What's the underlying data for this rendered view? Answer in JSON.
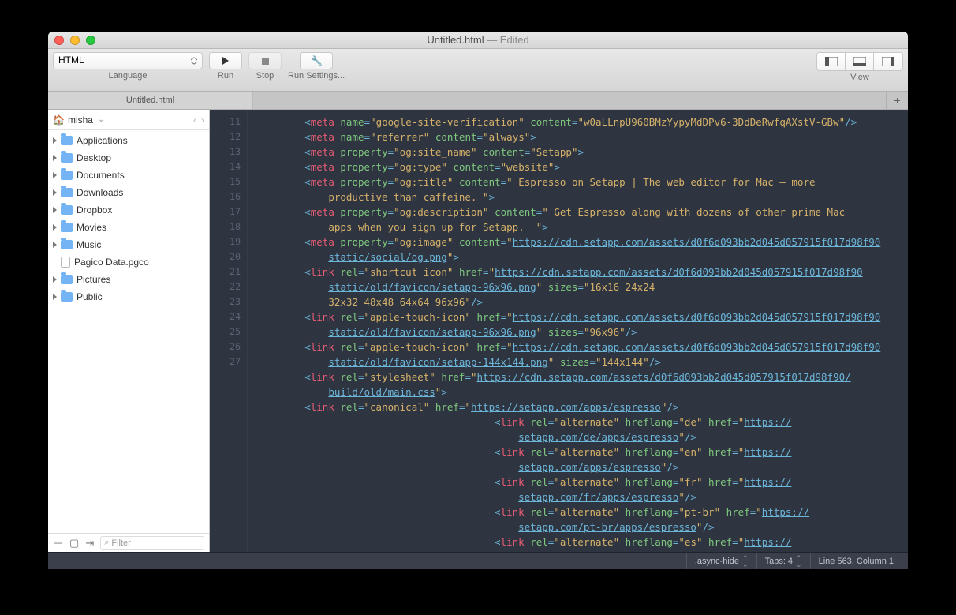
{
  "window": {
    "title": "Untitled.html",
    "edited_suffix": " — Edited"
  },
  "toolbar": {
    "language_label": "Language",
    "language_value": "HTML",
    "run_label": "Run",
    "stop_label": "Stop",
    "runsettings_label": "Run Settings...",
    "view_label": "View"
  },
  "tab": {
    "title": "Untitled.html"
  },
  "sidebar": {
    "path_user": "misha",
    "filter_placeholder": "Filter",
    "items": [
      {
        "type": "folder",
        "label": "Applications"
      },
      {
        "type": "folder",
        "label": "Desktop"
      },
      {
        "type": "folder",
        "label": "Documents"
      },
      {
        "type": "folder",
        "label": "Downloads"
      },
      {
        "type": "folder",
        "label": "Dropbox"
      },
      {
        "type": "folder",
        "label": "Movies"
      },
      {
        "type": "folder",
        "label": "Music"
      },
      {
        "type": "file",
        "label": "Pagico Data.pgco"
      },
      {
        "type": "folder",
        "label": "Pictures"
      },
      {
        "type": "folder",
        "label": "Public"
      }
    ]
  },
  "editor": {
    "line_numbers": [
      11,
      12,
      13,
      14,
      15,
      "",
      16,
      "",
      17,
      "",
      18,
      "",
      "",
      19,
      "",
      20,
      "",
      21,
      "",
      22,
      23,
      "",
      24,
      "",
      25,
      "",
      26,
      "",
      27
    ]
  },
  "code": {
    "l11_name": "name",
    "l11_name_v": "google-site-verification",
    "l11_content": "content",
    "l11_content_v": "w0aLLnpU960BMzYypyMdDPv6-3DdDeRwfqAXstV-GBw",
    "l12_name_v": "referrer",
    "l12_content_v": "always",
    "l13_prop": "property",
    "l13_prop_v": "og:site_name",
    "l13_content_v": "Setapp",
    "l14_prop_v": "og:type",
    "l14_content_v": "website",
    "l15_prop_v": "og:title",
    "l15_content_v": " Espresso on Setapp | The web editor for Mac — more productive than caffeine. ",
    "l16_prop_v": "og:description",
    "l16_content_v": " Get Espresso along with dozens of other prime Mac apps when you sign up for Setapp.  ",
    "l17_prop_v": "og:image",
    "l17_url": "https://cdn.setapp.com/assets/d0f6d093bb2d045d057915f017d98f90/static/social/og.png",
    "l18_rel": "rel",
    "l18_rel_v": "shortcut icon",
    "l18_href": "href",
    "l18_url": "https://cdn.setapp.com/assets/d0f6d093bb2d045d057915f017d98f90/static/old/favicon/setapp-96x96.png",
    "l18_sizes": "sizes",
    "l18_sizes_v": "16x16 24x24 32x32 48x48 64x64 96x96",
    "l19_rel_v": "apple-touch-icon",
    "l19_url": "https://cdn.setapp.com/assets/d0f6d093bb2d045d057915f017d98f90/static/old/favicon/setapp-96x96.png",
    "l19_sizes_v": "96x96",
    "l20_rel_v": "apple-touch-icon",
    "l20_url": "https://cdn.setapp.com/assets/d0f6d093bb2d045d057915f017d98f90/static/old/favicon/setapp-144x144.png",
    "l20_sizes_v": "144x144",
    "l21_rel_v": "stylesheet",
    "l21_url": "https://cdn.setapp.com/assets/d0f6d093bb2d045d057915f017d98f90/build/old/main.css",
    "l22_rel_v": "canonical",
    "l22_url": "https://setapp.com/apps/espresso",
    "l23_rel_v": "alternate",
    "l23_hreflang": "hreflang",
    "l23_lang": "de",
    "l23_url": "https://setapp.com/de/apps/espresso",
    "l24_lang": "en",
    "l24_url": "https://setapp.com/apps/espresso",
    "l25_lang": "fr",
    "l25_url": "https://setapp.com/fr/apps/espresso",
    "l26_lang": "pt-br",
    "l26_url": "https://setapp.com/pt-br/apps/espresso",
    "l27_lang": "es",
    "l27_url_prefix": "https://"
  },
  "status": {
    "class": ".async-hide",
    "indent": "Tabs: 4",
    "pos": "Line 563, Column 1"
  }
}
